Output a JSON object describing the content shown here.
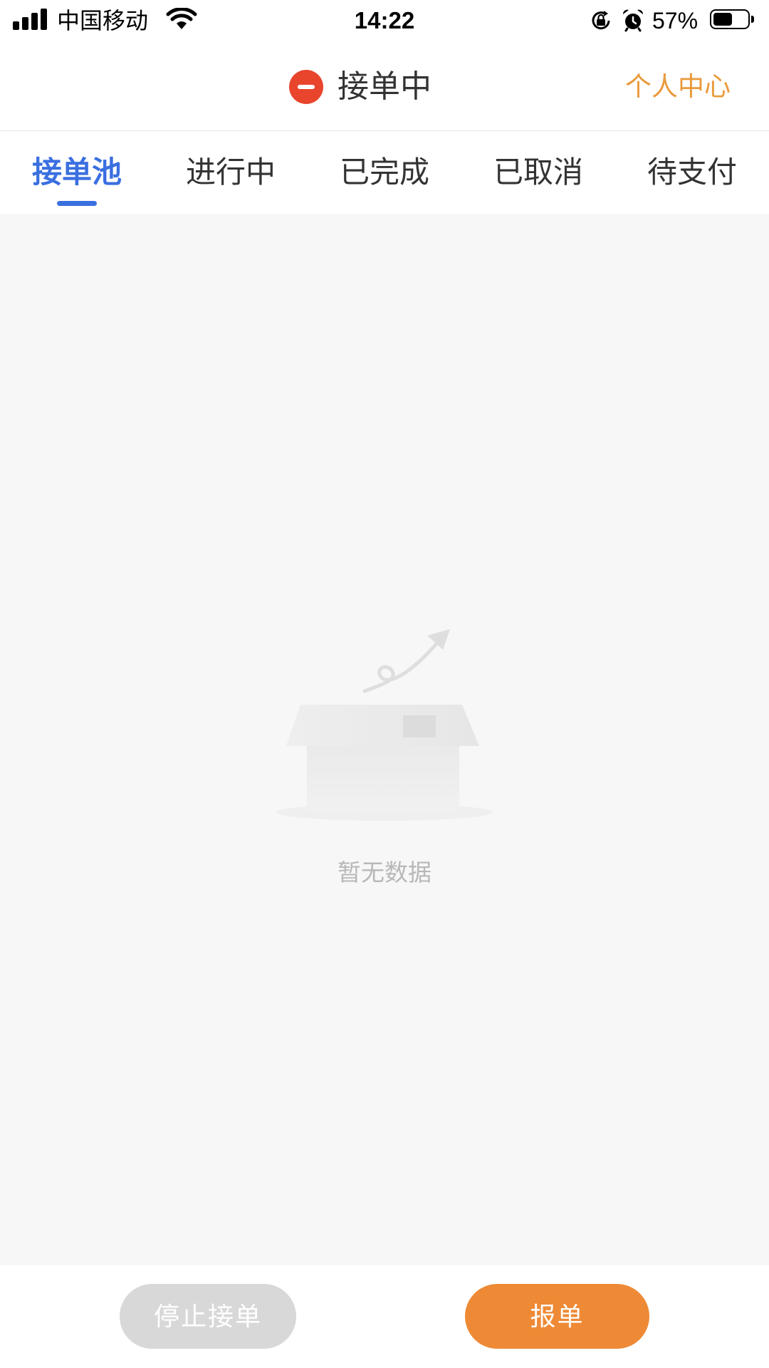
{
  "status_bar": {
    "carrier": "中国移动",
    "time": "14:22",
    "battery_percent": "57%",
    "icons": [
      "signal-icon",
      "wifi-icon",
      "orientation-lock-icon",
      "alarm-icon",
      "battery-icon"
    ]
  },
  "header": {
    "title": "接单中",
    "status_icon": "minus-circle-icon",
    "profile_link": "个人中心"
  },
  "tabs": [
    {
      "label": "接单池",
      "active": true
    },
    {
      "label": "进行中",
      "active": false
    },
    {
      "label": "已完成",
      "active": false
    },
    {
      "label": "已取消",
      "active": false
    },
    {
      "label": "待支付",
      "active": false
    }
  ],
  "empty_state": {
    "icon": "empty-box-icon",
    "text": "暂无数据"
  },
  "actions": {
    "stop_label": "停止接单",
    "report_label": "报单"
  },
  "colors": {
    "accent": "#3a6fe0",
    "orange": "#ee8a36",
    "orange_text": "#ea9a3c",
    "danger": "#e8452c",
    "disabled": "#d8d8d8"
  }
}
